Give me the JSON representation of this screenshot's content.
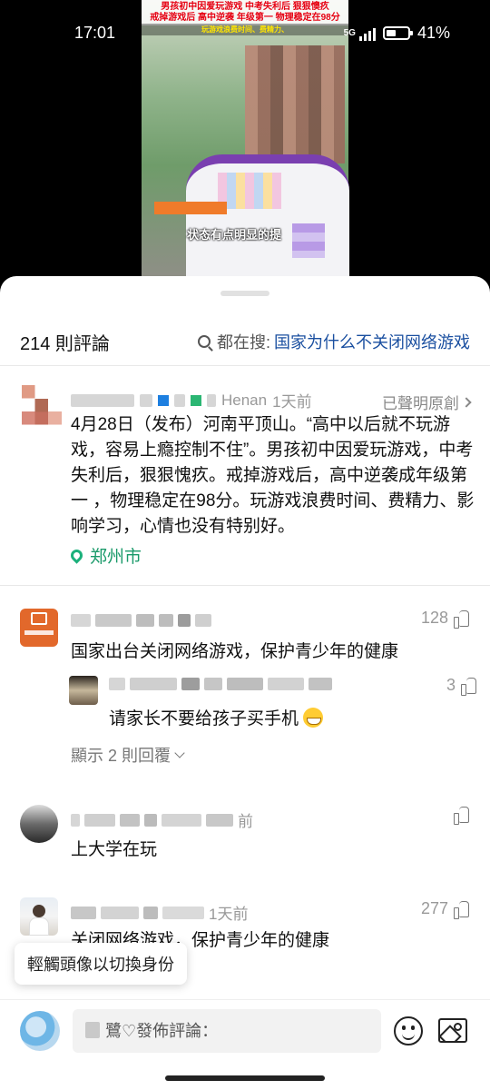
{
  "status_bar": {
    "time": "17:01",
    "network": "5G",
    "battery": "41%"
  },
  "video": {
    "caption_line1": "男孩初中因爱玩游戏 中考失利后 狠狠懊疚",
    "caption_line2": "戒掉游戏后 高中逆袭 年级第一 物理稳定在98分",
    "caption_yellow": "玩游戏浪费时间、费精力、",
    "subtitle": "状态有点明显的提"
  },
  "header": {
    "comment_count": "214 則評論",
    "search_prefix": "都在搜:",
    "search_term": "国家为什么不关闭网络游戏"
  },
  "post": {
    "location_source": "Henan",
    "time": "1天前",
    "original": "已聲明原創",
    "text": "4月28日（发布）河南平顶山。“高中以后就不玩游戏，容易上瘾控制不住”。男孩初中因爱玩游戏，中考失利后，狠狠愧疚。戒掉游戏后，高中逆袭成年级第一 ，物理稳定在98分。玩游戏浪费时间、费精力、影响学习，心情也没有特别好。",
    "location": "郑州市"
  },
  "comments": [
    {
      "likes": "128",
      "text": "国家出台关闭网络游戏，保护青少年的健康",
      "reply": {
        "likes": "3",
        "text": "请家长不要给孩子买手机"
      },
      "show_replies": "顯示 2 則回覆"
    },
    {
      "time": "前",
      "text": "上大学在玩"
    },
    {
      "time": "1天前",
      "likes": "277",
      "text": "关闭网络游戏，保护青少年的健康"
    }
  ],
  "tooltip": "輕觸頭像以切換身份",
  "input_bar": {
    "placeholder": "鷺♡發佈評論："
  }
}
